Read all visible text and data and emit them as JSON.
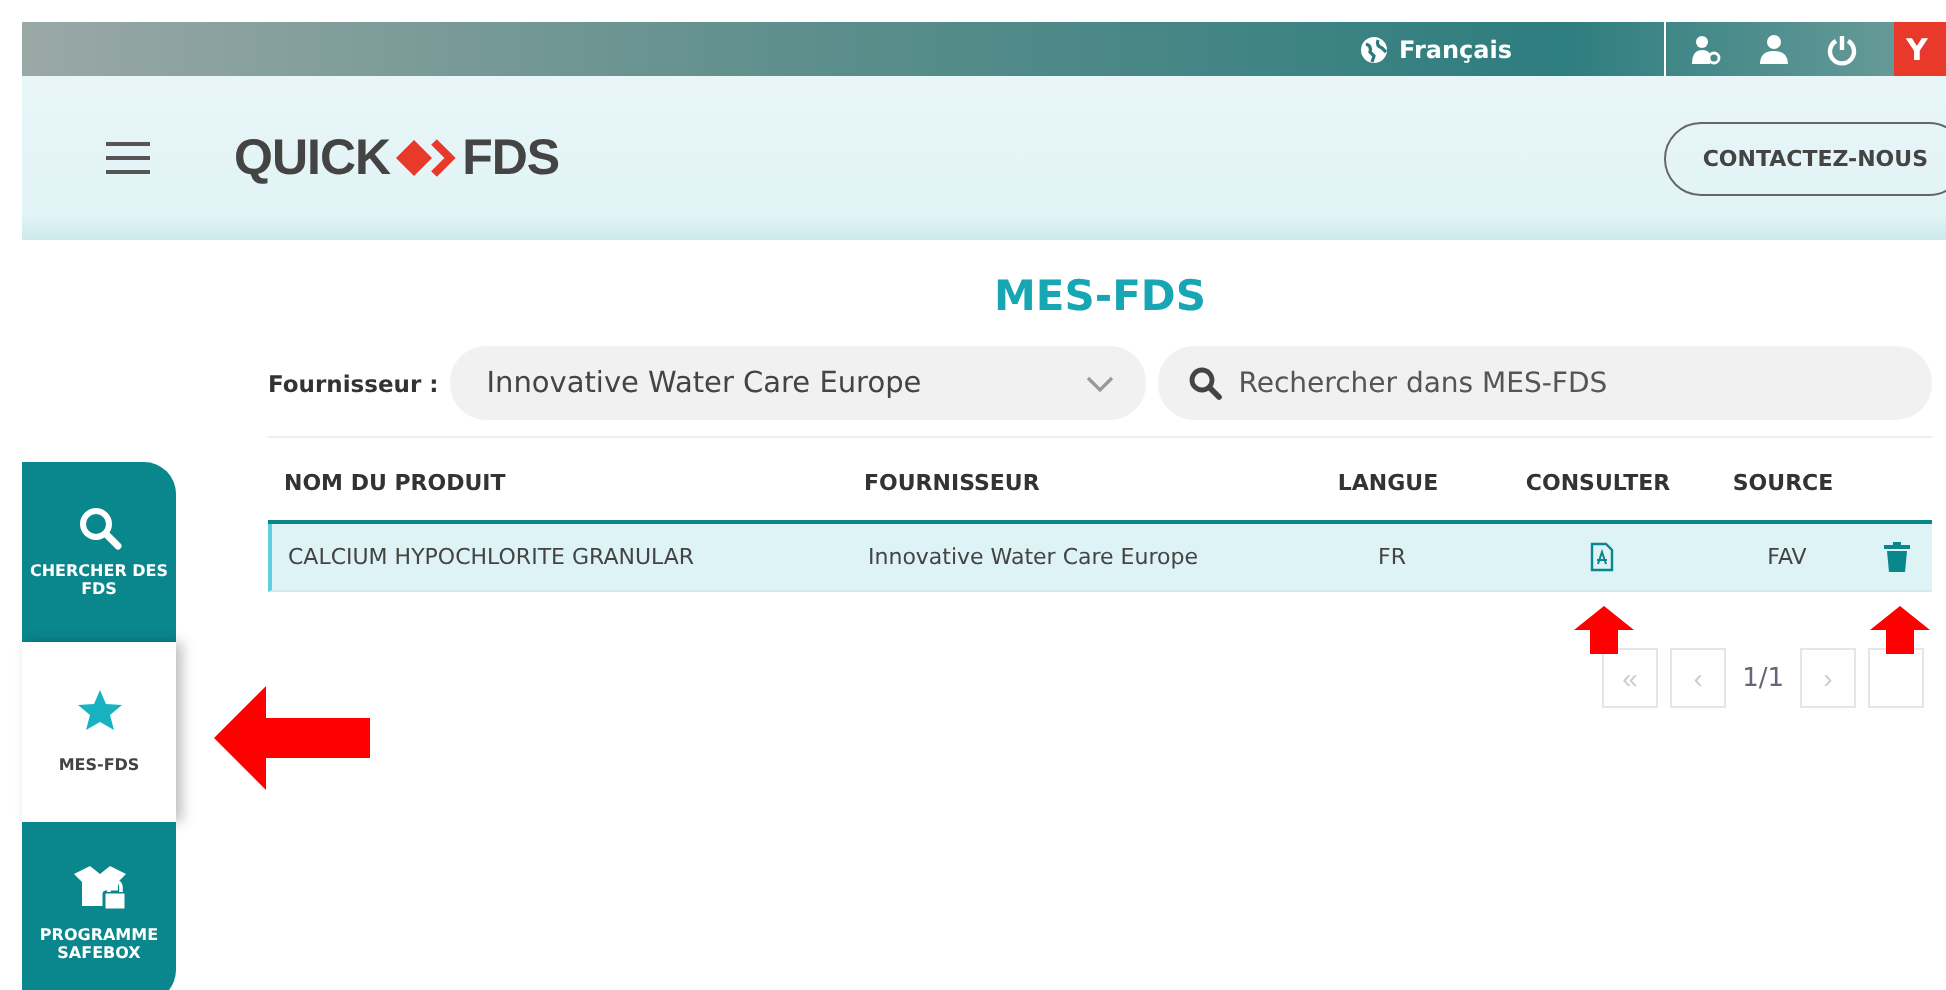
{
  "top_bar": {
    "language": "Français",
    "user_badge": "Y"
  },
  "header": {
    "logo_left": "QUICK",
    "logo_right": "FDS",
    "contact_button": "CONTACTEZ-NOUS"
  },
  "sidebar": {
    "items": [
      {
        "label": "CHERCHER DES FDS",
        "kind": "search",
        "selected": false
      },
      {
        "label": "MES-FDS",
        "kind": "favorites",
        "selected": true
      },
      {
        "label": "PROGRAMME SAFEBOX",
        "kind": "safebox",
        "selected": false
      }
    ]
  },
  "page_title": "MES-FDS",
  "filters": {
    "supplier_label": "Fournisseur :",
    "supplier_value": "Innovative Water Care Europe",
    "search_placeholder": "Rechercher dans MES-FDS"
  },
  "table": {
    "columns": [
      "NOM DU PRODUIT",
      "FOURNISSEUR",
      "LANGUE",
      "CONSULTER",
      "SOURCE"
    ],
    "rows": [
      {
        "product": "CALCIUM HYPOCHLORITE GRANULAR",
        "supplier": "Innovative Water Care Europe",
        "language": "FR",
        "source": "FAV",
        "selected": true
      }
    ]
  },
  "pagination": {
    "first": "«",
    "prev": "‹",
    "page": "1/1",
    "next": "›"
  }
}
